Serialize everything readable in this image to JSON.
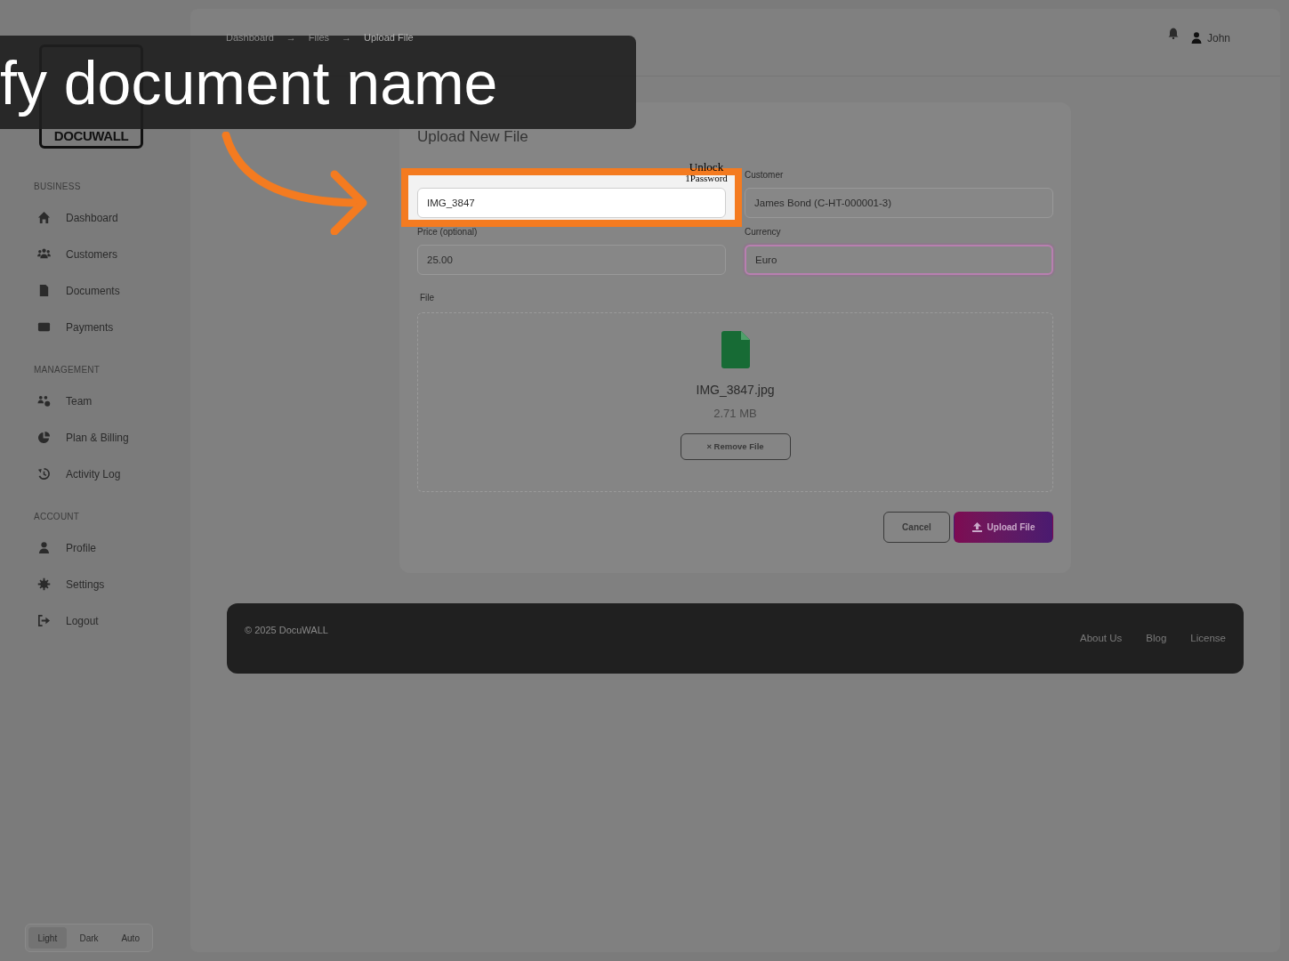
{
  "overlay": {
    "caption": "fy document name",
    "popup": [
      "Unlock",
      "1Password"
    ]
  },
  "sidebar": {
    "logo": "DOCUWALL",
    "sections": [
      {
        "heading": "BUSINESS",
        "items": [
          {
            "label": "Dashboard"
          },
          {
            "label": "Customers"
          },
          {
            "label": "Documents"
          },
          {
            "label": "Payments"
          }
        ]
      },
      {
        "heading": "MANAGEMENT",
        "items": [
          {
            "label": "Team"
          },
          {
            "label": "Plan & Billing"
          },
          {
            "label": "Activity Log"
          }
        ]
      },
      {
        "heading": "ACCOUNT",
        "items": [
          {
            "label": "Profile"
          },
          {
            "label": "Settings"
          },
          {
            "label": "Logout"
          }
        ]
      }
    ],
    "theme_switch": [
      {
        "label": "Light",
        "selected": true
      },
      {
        "label": "Dark",
        "selected": false
      },
      {
        "label": "Auto",
        "selected": false
      }
    ]
  },
  "header": {
    "breadcrumb": [
      "Dashboard",
      "→",
      "Files",
      "→",
      "Upload File"
    ],
    "user": "John"
  },
  "form": {
    "title": "Upload New File",
    "fields": [
      {
        "value": "IMG_3847",
        "highlighted": true,
        "focused": false
      },
      {
        "label": "Customer",
        "value": "James Bond (C-HT-000001-3)",
        "highlighted": false,
        "focused": false
      },
      {
        "label": "Price (optional)",
        "value": "25.00",
        "highlighted": false,
        "focused": false
      },
      {
        "label": "Currency",
        "value": "Euro",
        "highlighted": false,
        "focused": true
      }
    ],
    "file": {
      "label": "File",
      "name": "IMG_3847.jpg",
      "size": "2.71 MB",
      "remove": "× Remove File"
    },
    "buttons": [
      {
        "label": "Cancel",
        "kind": "secondary"
      },
      {
        "label": "Upload File",
        "kind": "primary"
      }
    ]
  },
  "footer": {
    "copyright": "© 2025 DocuWALL",
    "links": [
      "About Us",
      "Blog",
      "License"
    ]
  }
}
